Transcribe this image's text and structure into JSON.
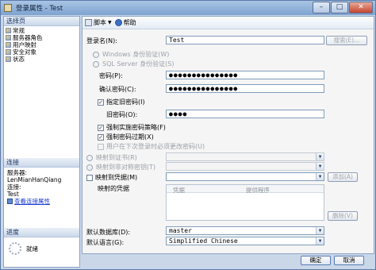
{
  "window": {
    "title": "登录属性 - Test"
  },
  "title_buttons": {
    "minimize": "–",
    "maximize": "□",
    "close": "✕"
  },
  "left": {
    "select_page_header": "选择页",
    "pages": [
      "常规",
      "服务器角色",
      "用户映射",
      "安全对象",
      "状态"
    ],
    "connection_header": "连接",
    "server_label": "服务器:",
    "server_value": "LenMianHanQiang",
    "connection_label": "连接:",
    "connection_value": "Test",
    "view_connection_props": "查看连接属性",
    "progress_header": "进度",
    "progress_status": "就绪"
  },
  "toolbar": {
    "script": "脚本",
    "help": "帮助"
  },
  "form": {
    "login_name_label": "登录名(N):",
    "login_name_value": "Test",
    "search_button": "搜索(E)...",
    "windows_auth": "Windows 身份验证(W)",
    "sql_auth": "SQL Server 身份验证(S)",
    "password_label": "密码(P):",
    "password_value": "●●●●●●●●●●●●●●●",
    "confirm_password_label": "确认密码(C):",
    "confirm_password_value": "●●●●●●●●●●●●●●●",
    "specify_old_password": "指定旧密码(I)",
    "old_password_label": "旧密码(O):",
    "old_password_value": "●●●●",
    "enforce_policy": "强制实施密码策略(F)",
    "enforce_expiration": "强制密码过期(X)",
    "must_change": "用户在下次登录时必须更改密码(U)",
    "map_to_certificate": "映射到证书(R)",
    "map_to_asym_key": "映射到非对称密钥(T)",
    "map_to_credential": "映射到凭据(M)",
    "add_button": "添加(A)",
    "mapped_credentials_label": "映射的凭据",
    "grid_col_credential": "凭据",
    "grid_col_provider": "提供程序",
    "remove_button": "删除(V)",
    "default_db_label": "默认数据库(D):",
    "default_db_value": "master",
    "default_lang_label": "默认语言(G):",
    "default_lang_value": "Simplified Chinese"
  },
  "footer": {
    "ok": "确定",
    "cancel": "取消"
  }
}
